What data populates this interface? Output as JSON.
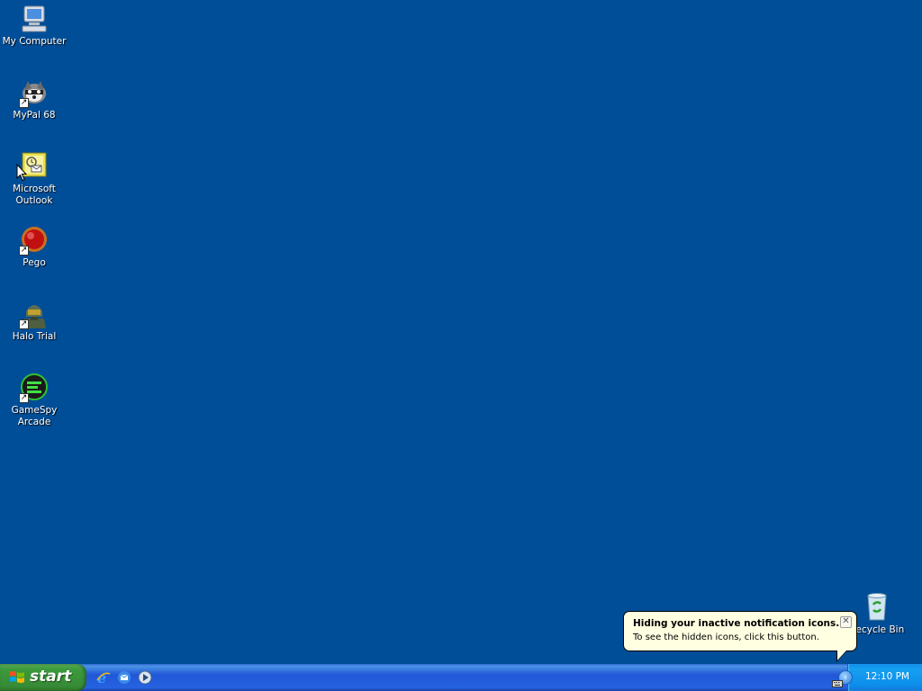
{
  "desktop": {
    "icons": [
      {
        "label": "My Computer",
        "icon": "my-computer-icon"
      },
      {
        "label": "MyPal 68",
        "icon": "mypal-icon"
      },
      {
        "label": "Microsoft Outlook",
        "icon": "outlook-icon"
      },
      {
        "label": "Pego",
        "icon": "pego-icon"
      },
      {
        "label": "Halo Trial",
        "icon": "halo-icon"
      },
      {
        "label": "GameSpy Arcade",
        "icon": "gamespy-icon"
      },
      {
        "label": "Recycle Bin",
        "icon": "recycle-bin-icon"
      }
    ],
    "background_color": "#004E98"
  },
  "balloon": {
    "title": "Hiding your inactive notification icons...",
    "text": "To see the hidden icons, click this button.",
    "close_icon": "close-icon"
  },
  "taskbar": {
    "start_label": "start",
    "quick_launch": [
      "internet-explorer-icon",
      "outlook-express-icon",
      "media-player-icon"
    ],
    "tray": {
      "time": "12:10 PM",
      "show_hidden_icon": "chevron-left-icon",
      "keyboard_icon": "keyboard-icon"
    }
  },
  "colors": {
    "taskbar_blue": "#2458D6",
    "start_green": "#3C9A3C",
    "tray_blue": "#0C8DEA",
    "balloon_bg": "#FFFFE1"
  }
}
